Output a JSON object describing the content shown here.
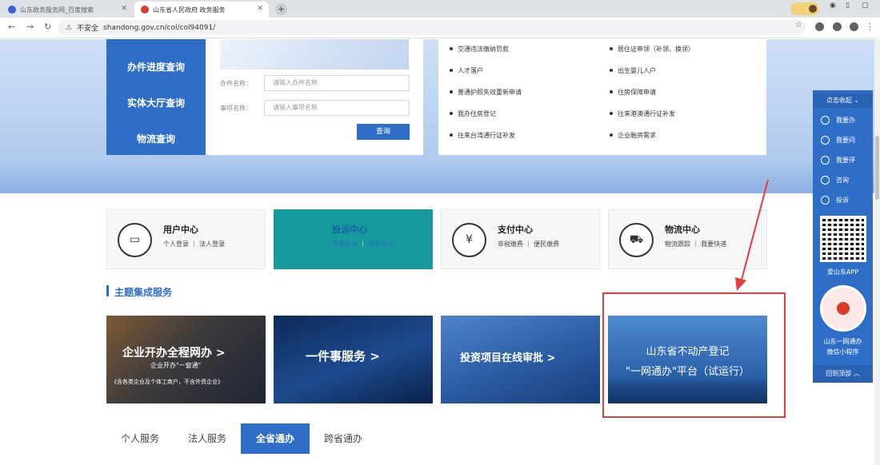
{
  "browser": {
    "tabs": [
      {
        "title": "山东政务服务网_百度搜索"
      },
      {
        "title": "山东省人民政府 政务服务"
      }
    ],
    "new_tab": "+",
    "address": {
      "security": "不安全",
      "url": "shandong.gov.cn/col/col94091/"
    }
  },
  "left_nav": {
    "items": [
      "办件进度查询",
      "实体大厅查询",
      "物流查询"
    ]
  },
  "query_panel": {
    "fields": [
      {
        "label": "办件名称：",
        "placeholder": "请输入办件名称"
      },
      {
        "label": "事项名称：",
        "placeholder": "请输入事项名称"
      }
    ],
    "submit": "查询"
  },
  "quick_links": {
    "left": [
      "交通违法缴纳罚款",
      "人才落户",
      "普通护照失效重新申请",
      "我办住房登记",
      "往来台湾通行证补发"
    ],
    "right": [
      "居住证申领（补领、换领）",
      "出生婴儿人户",
      "住房保障申请",
      "往来港澳通行证补发",
      "企业融资需求"
    ]
  },
  "center_cards": [
    {
      "title": "用户中心",
      "links": [
        "个人登录",
        "法人登录"
      ],
      "icon": "id-card-icon"
    },
    {
      "title": "投诉中心",
      "links": [
        "我要投诉",
        "我要咨询"
      ],
      "icon": "complaint-icon"
    },
    {
      "title": "支付中心",
      "links": [
        "非税缴费",
        "便民缴费"
      ],
      "icon": "yuan-coin-icon"
    },
    {
      "title": "物流中心",
      "links": [
        "物流跟踪",
        "我要快递"
      ],
      "icon": "delivery-truck-icon"
    }
  ],
  "section": {
    "title": "主题集成服务"
  },
  "banners": [
    {
      "title": "企业开办全程网办 >",
      "subtitle": "企业开办\"一窗通\"",
      "note": "《含各类企业及个体工商户，不含外资企业》"
    },
    {
      "title": "一件事服务 >"
    },
    {
      "title": "投资项目在线审批 >"
    },
    {
      "line1": "山东省不动产登记",
      "line2": "\"一网通办\"平台（试运行）"
    }
  ],
  "bottom_tabs": [
    "个人服务",
    "法人服务",
    "全省通办",
    "跨省通办"
  ],
  "bottom_tabs_active": 2,
  "right_bar": {
    "header": "点击收起",
    "items": [
      "我要办",
      "我要问",
      "我要评",
      "咨询",
      "投诉"
    ],
    "app_caption": "爱山东APP",
    "mini_caption_1": "山东一网通办",
    "mini_caption_2": "微信小程序",
    "footer": "回到顶部"
  },
  "colors": {
    "primary": "#2f6ec7",
    "active_card": "#179a9b",
    "highlight": "#e53b3b"
  }
}
